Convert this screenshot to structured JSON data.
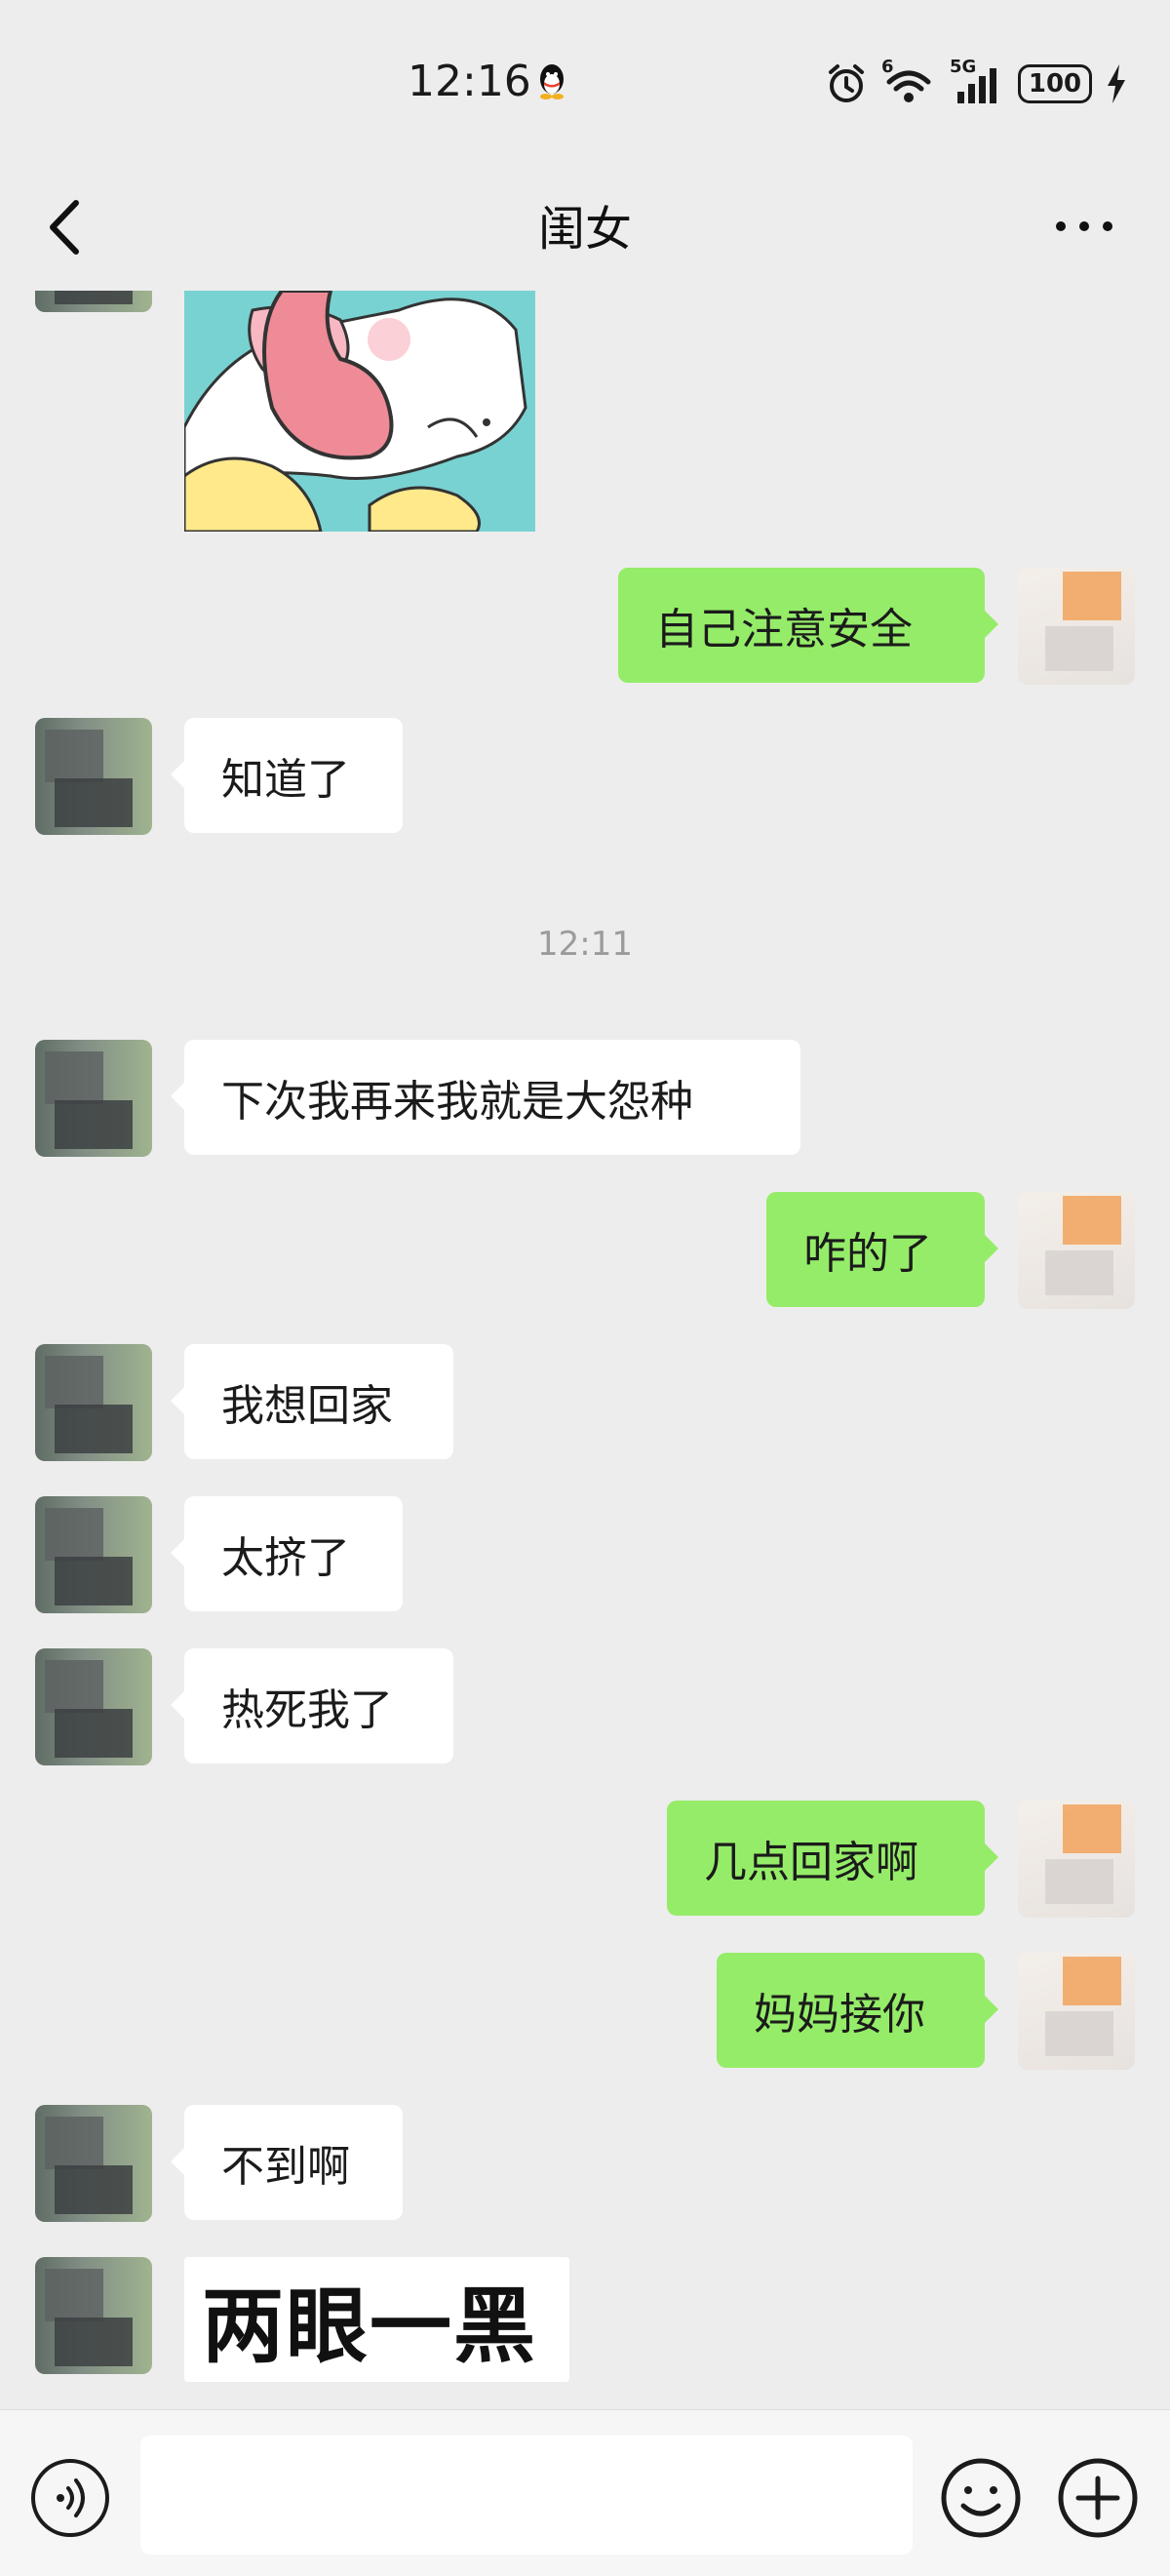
{
  "status_bar": {
    "time": "12:16",
    "battery": "100",
    "network": "5G",
    "wifi_sup": "6"
  },
  "header": {
    "title": "闺女"
  },
  "messages": [
    {
      "from": "me",
      "text": "自己注意安全"
    },
    {
      "from": "daughter",
      "text": "知道了"
    },
    {
      "time": "12:11"
    },
    {
      "from": "daughter",
      "text": "下次我再来我就是大怨种"
    },
    {
      "from": "me",
      "text": "咋的了"
    },
    {
      "from": "daughter",
      "text": "我想回家"
    },
    {
      "from": "daughter",
      "text": "太挤了"
    },
    {
      "from": "daughter",
      "text": "热死我了"
    },
    {
      "from": "me",
      "text": "几点回家啊"
    },
    {
      "from": "me",
      "text": "妈妈接你"
    },
    {
      "from": "daughter",
      "text": "不到啊"
    },
    {
      "from": "daughter",
      "sticker_text": "两眼一黑"
    }
  ],
  "input": {
    "placeholder": ""
  }
}
